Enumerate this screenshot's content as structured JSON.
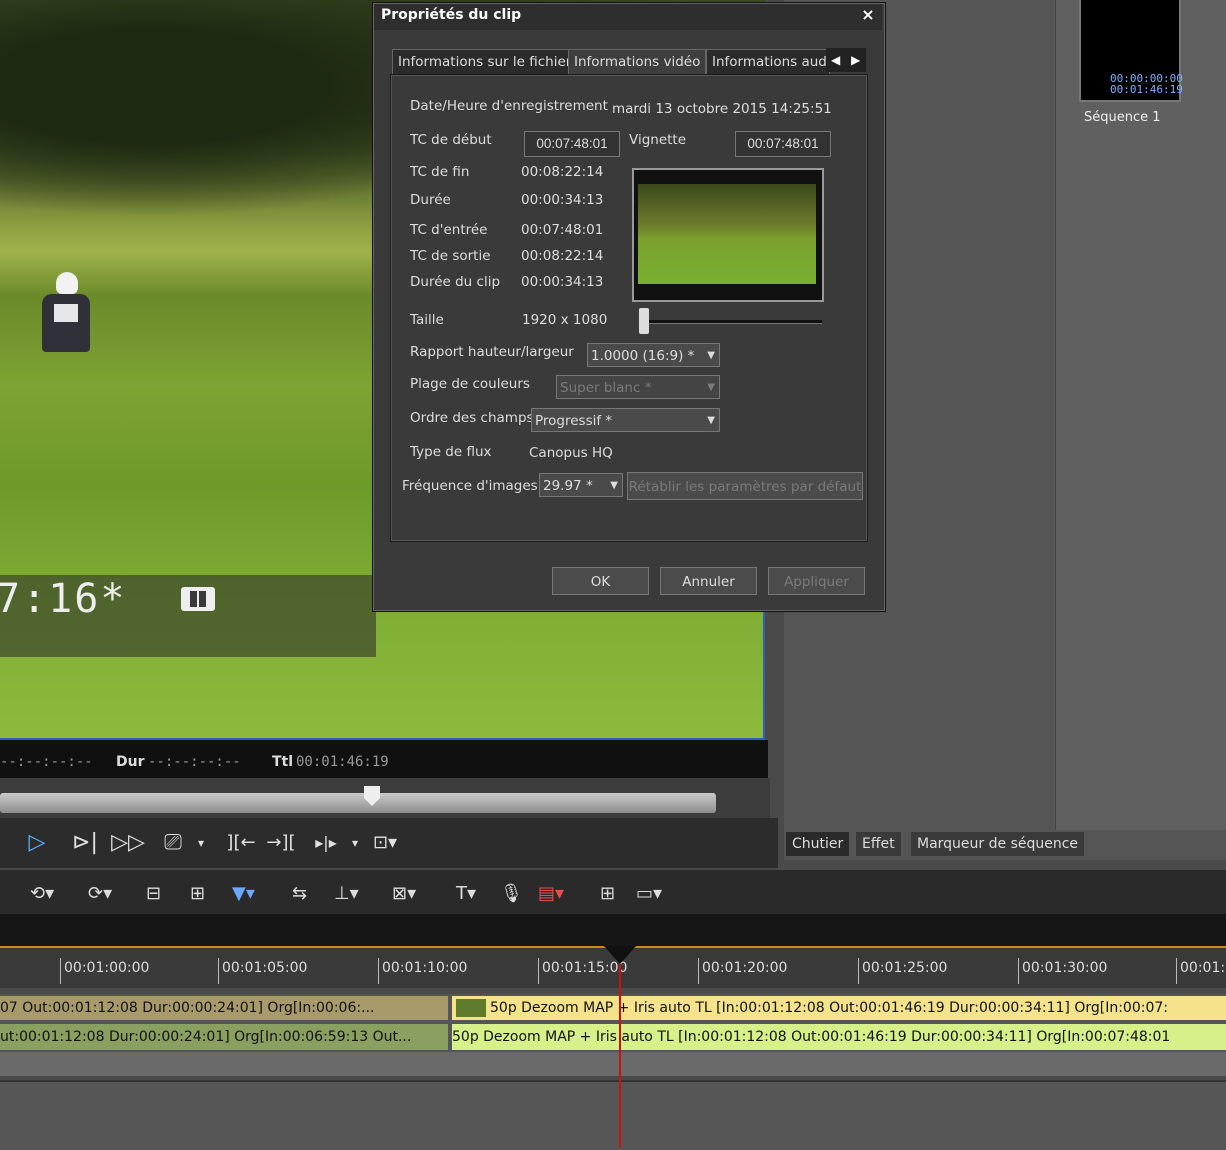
{
  "preview": {
    "timecode": "7:16*",
    "status": {
      "in_value": "--:--:--:--",
      "dur_label": "Dur",
      "dur_value": "--:--:--:--",
      "ttl_label": "Ttl",
      "ttl_value": "00:01:46:19"
    },
    "scrub_position": 0.52
  },
  "transport_icons": [
    "play-icon",
    "play-frame-icon",
    "fast-forward-icon",
    "loop-icon",
    "set-in-icon",
    "set-out-icon",
    "insert-icon",
    "overwrite-icon"
  ],
  "bin": {
    "sequence_tc_in": "00:00:00:00",
    "sequence_tc_out": "00:01:46:19",
    "sequence_label": "Séquence 1",
    "tabs": [
      {
        "label": "Chutier"
      },
      {
        "label": "Effet"
      },
      {
        "label": "Marqueur de séquence"
      }
    ]
  },
  "toolbar_icons": [
    "undo-icon",
    "redo-icon",
    "split-icon",
    "ripple-icon",
    "marker-icon",
    "snap-icon",
    "trim-icon",
    "mix-icon",
    "title-icon",
    "microphone-icon",
    "render-icon",
    "grid-icon",
    "window-icon"
  ],
  "timeline": {
    "ruler": [
      "00:01:00:00",
      "00:01:05:00",
      "00:01:10:00",
      "00:01:15:00",
      "00:01:20:00",
      "00:01:25:00",
      "00:01:30:00",
      "00:01:3"
    ],
    "track1": {
      "clip_a": "07 Out:00:01:12:08 Dur:00:00:24:01]  Org[In:00:06:...",
      "clip_b": "50p Dezoom MAP + Iris auto  TL [In:00:01:12:08 Out:00:01:46:19 Dur:00:00:34:11]  Org[In:00:07:"
    },
    "track2": {
      "clip_a": "ut:00:01:12:08 Dur:00:00:24:01]  Org[In:00:06:59:13 Out...",
      "clip_b": "50p Dezoom MAP + Iris auto  TL [In:00:01:12:08 Out:00:01:46:19 Dur:00:00:34:11]  Org[In:00:07:48:01"
    }
  },
  "dialog": {
    "title": "Propriétés du clip",
    "close": "×",
    "tabs": [
      {
        "label": "Informations sur le fichier"
      },
      {
        "label": "Informations vidéo"
      },
      {
        "label": "Informations audio"
      }
    ],
    "rec_date_label": "Date/Heure d'enregistrement",
    "rec_date_value": "mardi 13 octobre 2015 14:25:51",
    "tc_start_label": "TC de début",
    "tc_start_value": "00:07:48:01",
    "thumbnail_label": "Vignette",
    "thumbnail_value": "00:07:48:01",
    "tc_end_label": "TC de fin",
    "tc_end_value": "00:08:22:14",
    "duration_label": "Durée",
    "duration_value": "00:00:34:13",
    "tc_in_label": "TC d'entrée",
    "tc_in_value": "00:07:48:01",
    "tc_out_label": "TC de sortie",
    "tc_out_value": "00:08:22:14",
    "clip_duration_label": "Durée du clip",
    "clip_duration_value": "00:00:34:13",
    "size_label": "Taille",
    "size_value": "1920 x 1080",
    "aspect_label": "Rapport hauteur/largeur",
    "aspect_value": "1.0000 (16:9) *",
    "color_range_label": "Plage de couleurs",
    "color_range_value": "Super blanc *",
    "field_order_label": "Ordre des champs",
    "field_order_value": "Progressif *",
    "stream_type_label": "Type de flux",
    "stream_type_value": "Canopus HQ",
    "frame_rate_label": "Fréquence d'images",
    "frame_rate_value": "29.97 *",
    "reset_button": "Rétablir les paramètres par défaut",
    "ok_button": "OK",
    "cancel_button": "Annuler",
    "apply_button": "Appliquer"
  }
}
